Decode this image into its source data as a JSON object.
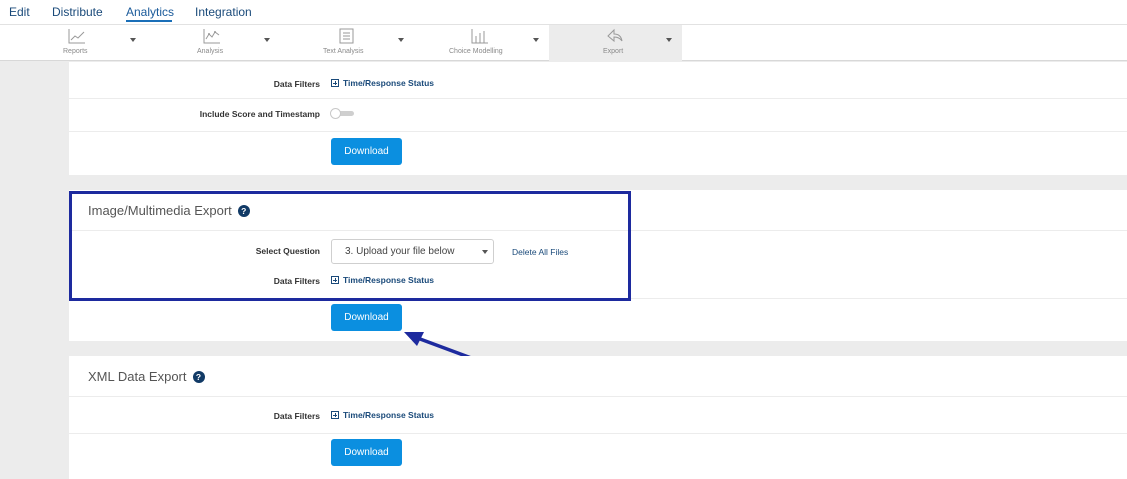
{
  "topnav": {
    "items": [
      {
        "label": "Edit"
      },
      {
        "label": "Distribute"
      },
      {
        "label": "Analytics"
      },
      {
        "label": "Integration"
      }
    ],
    "active": "Analytics"
  },
  "toolbar": {
    "tools": [
      {
        "label": "Reports",
        "icon": "line-chart-icon"
      },
      {
        "label": "Analysis",
        "icon": "analysis-chart-icon"
      },
      {
        "label": "Text Analysis",
        "icon": "text-analysis-icon"
      },
      {
        "label": "Choice Modelling",
        "icon": "choice-modelling-icon"
      },
      {
        "label": "Export",
        "icon": "export-icon"
      }
    ],
    "selected": "Export"
  },
  "section_top": {
    "data_filters_label": "Data Filters",
    "data_filters_link": "Time/Response Status",
    "score_label": "Include Score and Timestamp",
    "score_toggle_on": false,
    "download_label": "Download"
  },
  "section_image": {
    "title": "Image/Multimedia Export",
    "help": "?",
    "select_question_label": "Select Question",
    "select_question_value": "3. Upload your file below",
    "delete_all_label": "Delete All Files",
    "data_filters_label": "Data Filters",
    "data_filters_link": "Time/Response Status",
    "download_label": "Download"
  },
  "section_xml": {
    "title": "XML Data Export",
    "help": "?",
    "data_filters_label": "Data Filters",
    "data_filters_link": "Time/Response Status",
    "download_label": "Download"
  },
  "colors": {
    "accent": "#0b8fe0",
    "highlight_border": "#1d2a9e",
    "link": "#1a4a7a"
  }
}
